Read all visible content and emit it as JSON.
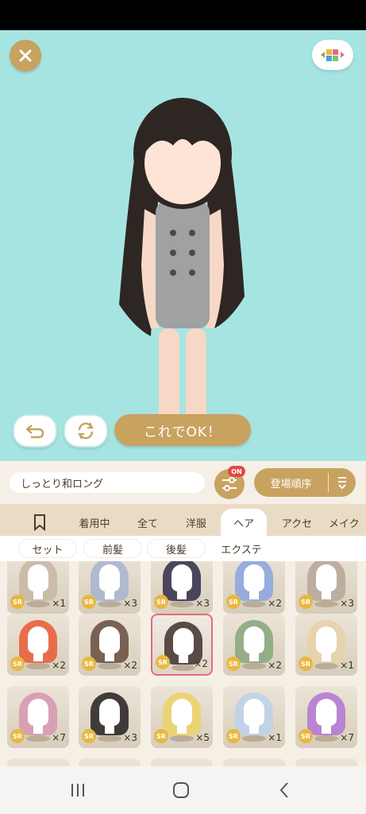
{
  "colors": {
    "accent": "#c8a25f",
    "stage_bg": "#a6e4e2",
    "badge_red": "#e04a48",
    "selected_border": "#e66b7b",
    "sr_gold": "#e9b842"
  },
  "header": {
    "close_icon": "close-icon",
    "palette_icon": "palette-icon"
  },
  "actions": {
    "undo_icon": "undo-icon",
    "rotate_icon": "rotate-icon",
    "ok_label": "これでOK！"
  },
  "controls": {
    "item_name": "しっとり和ロング",
    "filter_badge": "ON",
    "sort_label": "登場順序",
    "sort_icon": "sort-icon"
  },
  "tabs": [
    {
      "label": "",
      "icon": "bookmark-icon"
    },
    {
      "label": "着用中"
    },
    {
      "label": "全て"
    },
    {
      "label": "洋服"
    },
    {
      "label": "ヘア",
      "active": true
    },
    {
      "label": "アクセ"
    },
    {
      "label": "メイク"
    }
  ],
  "subtabs": [
    {
      "label": "セット"
    },
    {
      "label": "前髪"
    },
    {
      "label": "後髪"
    },
    {
      "label": "エクステ"
    }
  ],
  "items": [
    {
      "rarity": "SR",
      "count": "×1",
      "hair": "#c9b8a6"
    },
    {
      "rarity": "SR",
      "count": "×3",
      "hair": "#aab6cf"
    },
    {
      "rarity": "SR",
      "count": "×3",
      "hair": "#3b3550"
    },
    {
      "rarity": "SR",
      "count": "×2",
      "hair": "#8ea6e0"
    },
    {
      "rarity": "SR",
      "count": "×3",
      "hair": "#b8a99a"
    },
    {
      "rarity": "SR",
      "count": "×2",
      "hair": "#e8623c"
    },
    {
      "rarity": "SR",
      "count": "×2",
      "hair": "#6e5445"
    },
    {
      "rarity": "SR",
      "count": "×2",
      "hair": "#4a3a36",
      "selected": true
    },
    {
      "rarity": "SR",
      "count": "×2",
      "hair": "#8ba87e"
    },
    {
      "rarity": "SR",
      "count": "×1",
      "hair": "#e7d2a8"
    },
    {
      "rarity": "SR",
      "count": "×7",
      "hair": "#d79ab0"
    },
    {
      "rarity": "SR",
      "count": "×3",
      "hair": "#2f2a2a"
    },
    {
      "rarity": "SR",
      "count": "×5",
      "hair": "#ecd36a"
    },
    {
      "rarity": "SR",
      "count": "×1",
      "hair": "#bcd3ea"
    },
    {
      "rarity": "SR",
      "count": "×7",
      "hair": "#b57ad1"
    }
  ],
  "navbar": {
    "recent_icon": "recent-apps-icon",
    "home_icon": "home-icon",
    "back_icon": "back-icon"
  }
}
